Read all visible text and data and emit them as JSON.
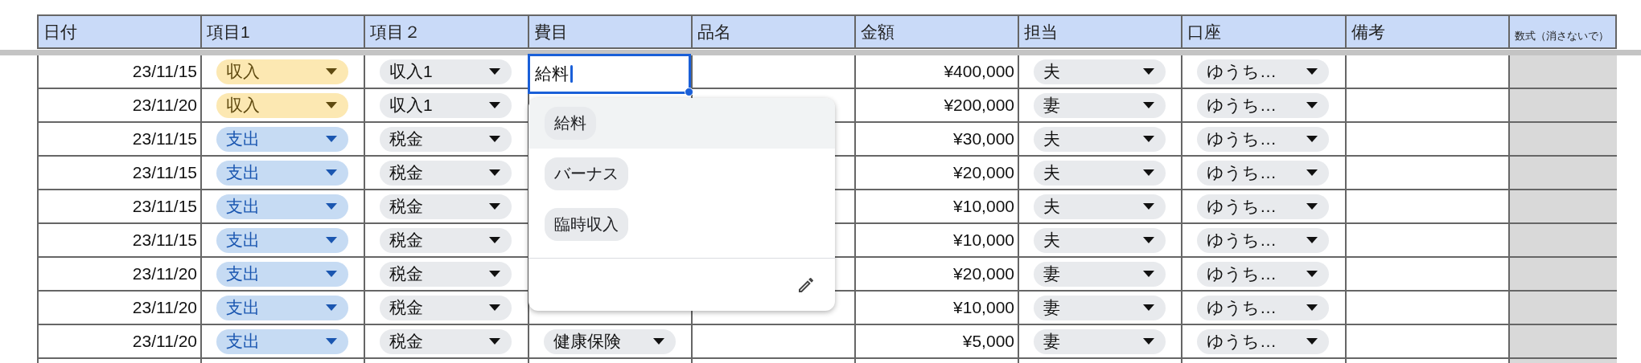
{
  "columns": [
    {
      "label": "日付",
      "kind": "normal"
    },
    {
      "label": "項目1",
      "kind": "normal"
    },
    {
      "label": "項目２",
      "kind": "normal"
    },
    {
      "label": "費目",
      "kind": "normal"
    },
    {
      "label": "品名",
      "kind": "normal"
    },
    {
      "label": "金額",
      "kind": "normal"
    },
    {
      "label": "担当",
      "kind": "normal"
    },
    {
      "label": "口座",
      "kind": "normal"
    },
    {
      "label": "備考",
      "kind": "normal"
    },
    {
      "label": "数式（消さないで）",
      "kind": "small"
    }
  ],
  "rows": [
    {
      "date": "23/11/15",
      "type1": {
        "text": "収入",
        "color": "#fce8b2"
      },
      "type2": "収入1",
      "category": {
        "kind": "editing",
        "text": "給料"
      },
      "amount": "¥400,000",
      "owner": "夫",
      "account": "ゆうち…"
    },
    {
      "date": "23/11/20",
      "type1": {
        "text": "収入",
        "color": "#fce8b2"
      },
      "type2": "収入1",
      "amount": "¥200,000",
      "owner": "妻",
      "account": "ゆうち…"
    },
    {
      "date": "23/11/15",
      "type1": {
        "text": "支出",
        "color": "#c6dbf3"
      },
      "type2": "税金",
      "amount": "¥30,000",
      "owner": "夫",
      "account": "ゆうち…"
    },
    {
      "date": "23/11/15",
      "type1": {
        "text": "支出",
        "color": "#c6dbf3"
      },
      "type2": "税金",
      "amount": "¥20,000",
      "owner": "夫",
      "account": "ゆうち…"
    },
    {
      "date": "23/11/15",
      "type1": {
        "text": "支出",
        "color": "#c6dbf3"
      },
      "type2": "税金",
      "amount": "¥10,000",
      "owner": "夫",
      "account": "ゆうち…"
    },
    {
      "date": "23/11/15",
      "type1": {
        "text": "支出",
        "color": "#c6dbf3"
      },
      "type2": "税金",
      "amount": "¥10,000",
      "owner": "夫",
      "account": "ゆうち…"
    },
    {
      "date": "23/11/20",
      "type1": {
        "text": "支出",
        "color": "#c6dbf3"
      },
      "type2": "税金",
      "amount": "¥20,000",
      "owner": "妻",
      "account": "ゆうち…"
    },
    {
      "date": "23/11/20",
      "type1": {
        "text": "支出",
        "color": "#c6dbf3"
      },
      "type2": "税金",
      "amount": "¥10,000",
      "owner": "妻",
      "account": "ゆうち…"
    },
    {
      "date": "23/11/20",
      "type1": {
        "text": "支出",
        "color": "#c6dbf3"
      },
      "type2": "税金",
      "category": {
        "kind": "chip",
        "text": "健康保険"
      },
      "amount": "¥5,000",
      "owner": "妻",
      "account": "ゆうち…"
    }
  ],
  "dropdown": {
    "options": [
      {
        "label": "給料",
        "selected": true
      },
      {
        "label": "バーナス",
        "selected": false
      },
      {
        "label": "臨時収入",
        "selected": false
      }
    ]
  }
}
